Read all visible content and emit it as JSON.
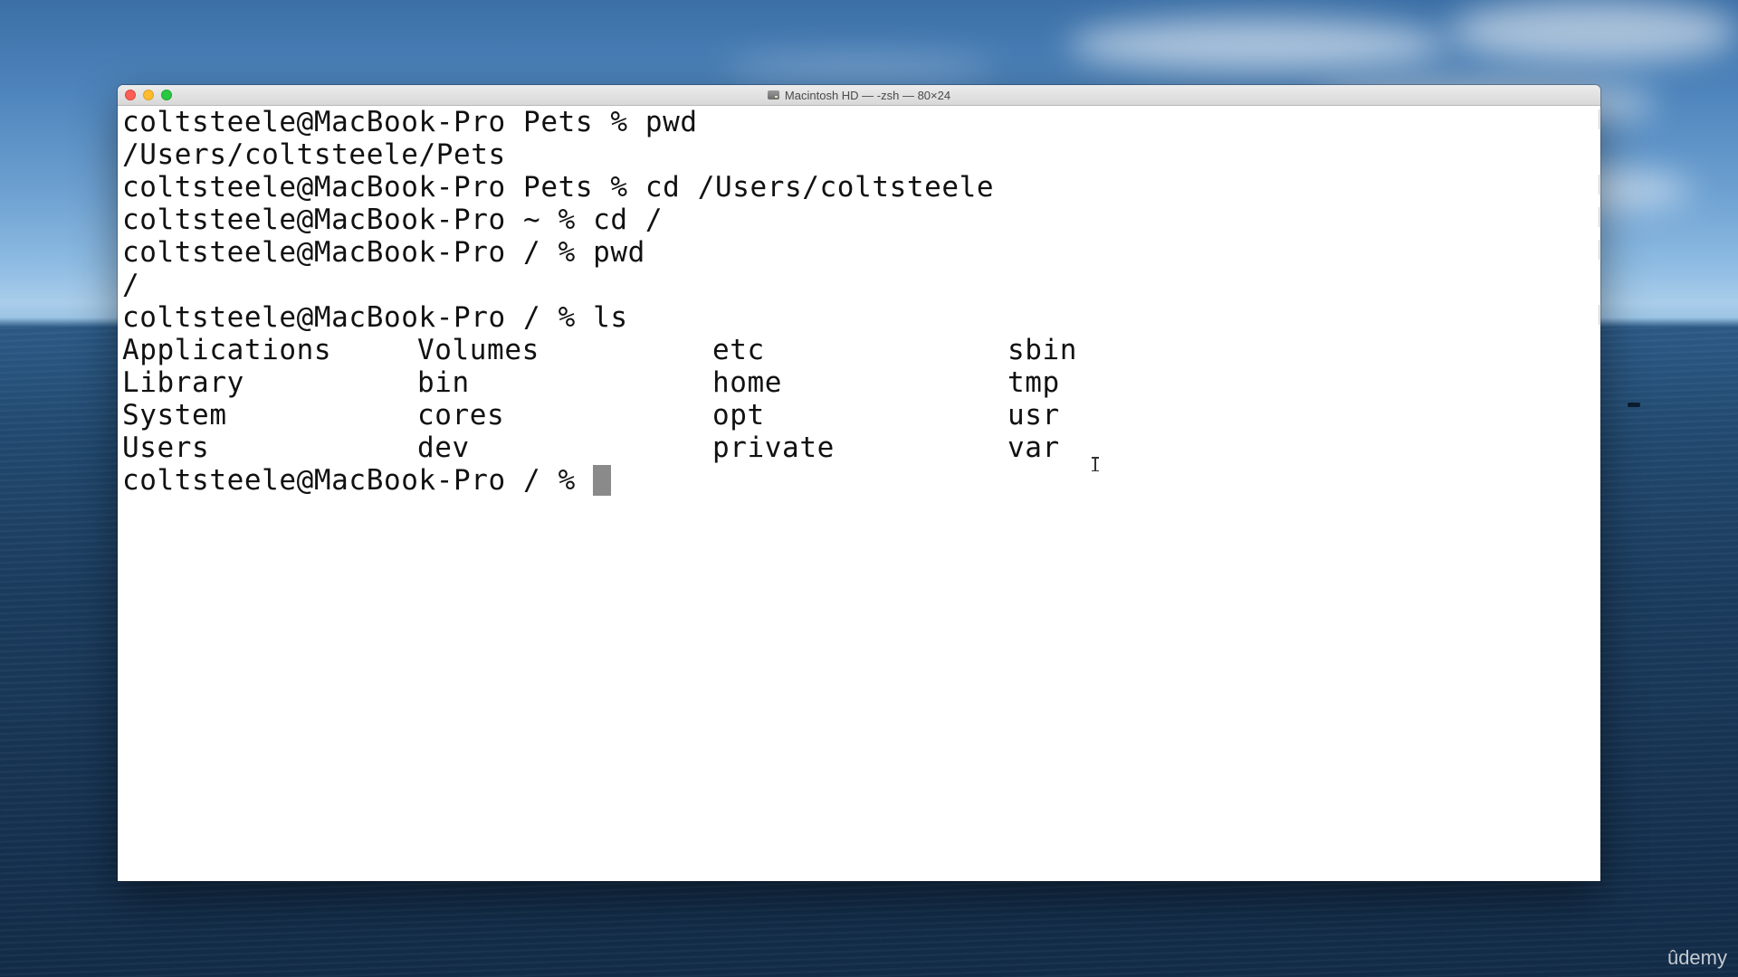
{
  "window": {
    "title": "Macintosh HD — -zsh — 80×24"
  },
  "terminal": {
    "lines": [
      "coltsteele@MacBook-Pro Pets % pwd",
      "/Users/coltsteele/Pets",
      "coltsteele@MacBook-Pro Pets % cd /Users/coltsteele",
      "coltsteele@MacBook-Pro ~ % cd /",
      "coltsteele@MacBook-Pro / % pwd",
      "/",
      "coltsteele@MacBook-Pro / % ls"
    ],
    "ls_output": [
      [
        "Applications",
        "Volumes",
        "etc",
        "sbin"
      ],
      [
        "Library",
        "bin",
        "home",
        "tmp"
      ],
      [
        "System",
        "cores",
        "opt",
        "usr"
      ],
      [
        "Users",
        "dev",
        "private",
        "var"
      ]
    ],
    "current_prompt": "coltsteele@MacBook-Pro / % "
  },
  "watermark": "ûdemy"
}
